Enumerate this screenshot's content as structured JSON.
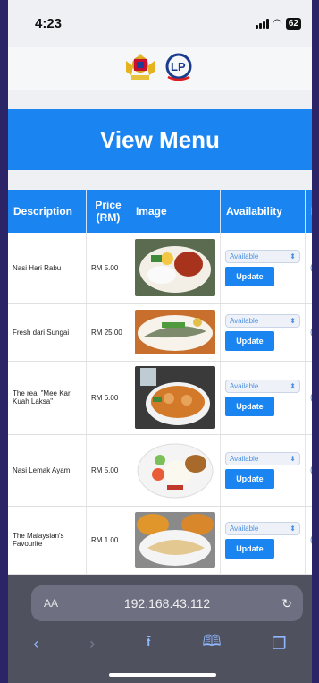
{
  "status": {
    "time": "4:23",
    "battery": "62"
  },
  "page": {
    "title": "View Menu"
  },
  "table": {
    "headers": [
      "Description",
      "Price\n(RM)",
      "Image",
      "Availability",
      "E"
    ],
    "rows": [
      {
        "description": "Nasi Hari Rabu",
        "price": "RM 5.00",
        "availability": "Available",
        "action": "Update"
      },
      {
        "description": "Fresh dari Sungai",
        "price": "RM 25.00",
        "availability": "Available",
        "action": "Update"
      },
      {
        "description": "The real \"Mee Kari Kuah Laksa\"",
        "price": "RM 6.00",
        "availability": "Available",
        "action": "Update"
      },
      {
        "description": "Nasi Lemak Ayam",
        "price": "RM 5.00",
        "availability": "Available",
        "action": "Update"
      },
      {
        "description": "The Malaysian's Favourite",
        "price": "RM 1.00",
        "availability": "Available",
        "action": "Update"
      }
    ]
  },
  "browser": {
    "aa": "AA",
    "url": "192.168.43.112"
  },
  "icons": [
    "back-icon",
    "forward-icon",
    "share-icon",
    "bookmarks-icon",
    "tabs-icon",
    "reload-icon"
  ]
}
